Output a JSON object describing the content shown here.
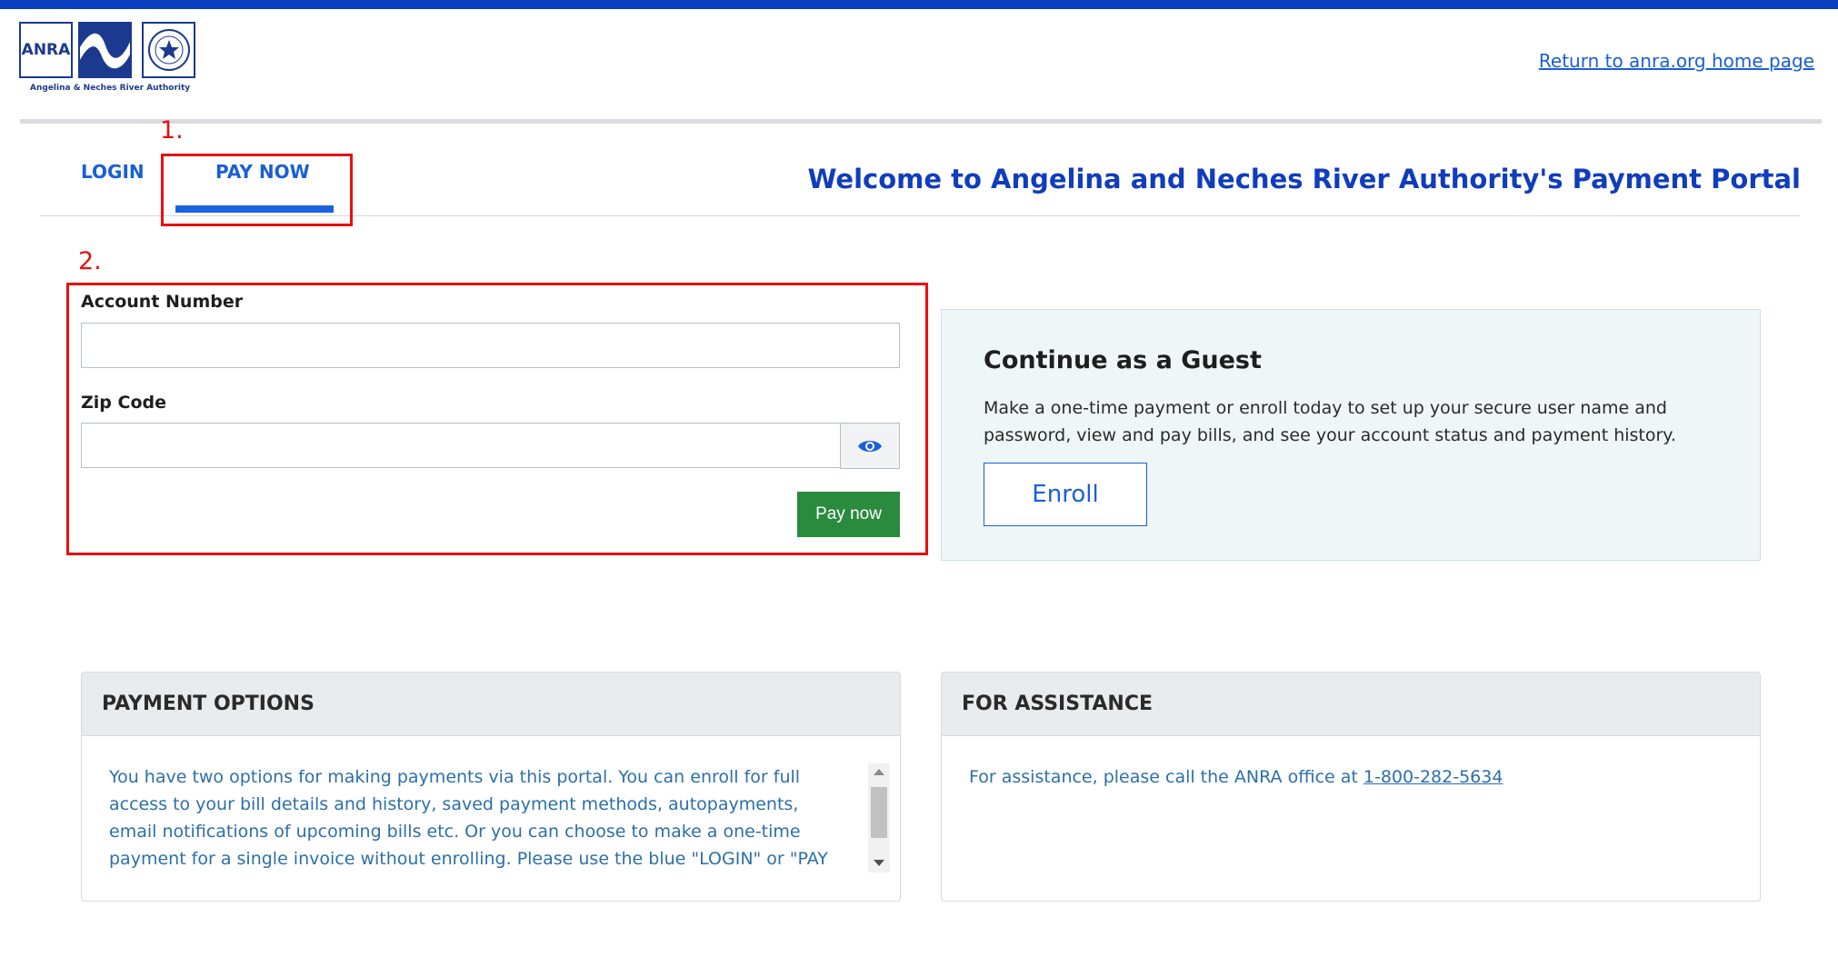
{
  "header": {
    "logo_text": "ANRA",
    "logo_caption": "Angelina & Neches River Authority",
    "return_link": "Return to anra.org home page"
  },
  "tabs": [
    {
      "label": "LOGIN",
      "active": false
    },
    {
      "label": "PAY NOW",
      "active": true
    }
  ],
  "welcome": "Welcome to Angelina and Neches River Authority's Payment Portal",
  "annotations": [
    "1.",
    "2."
  ],
  "form": {
    "account_label": "Account Number",
    "account_value": "",
    "zip_label": "Zip Code",
    "zip_value": "",
    "reveal_icon": "eye-icon",
    "submit_label": "Pay now"
  },
  "guest": {
    "title": "Continue as a Guest",
    "text": "Make a one-time payment or enroll today to set up your secure user name and password, view and pay bills, and see your account status and payment history.",
    "button": "Enroll"
  },
  "payment_options": {
    "title": "PAYMENT OPTIONS",
    "text": "You have two options for making payments via this portal. You can enroll for full access to your bill details and history, saved payment methods, autopayments, email notifications of upcoming bills etc. Or you can choose to make a one-time payment for a single invoice without enrolling. Please use the blue \"LOGIN\" or \"PAY NOW\" links at the top of the page to"
  },
  "assistance": {
    "title": "FOR ASSISTANCE",
    "text": "For assistance, please call the ANRA office at ",
    "phone": "1-800-282-5634"
  },
  "colors": {
    "brand_blue": "#0f3dbd",
    "link_blue": "#1a5fd6",
    "annotation_red": "#e81010",
    "pay_green": "#2a8a3e"
  }
}
